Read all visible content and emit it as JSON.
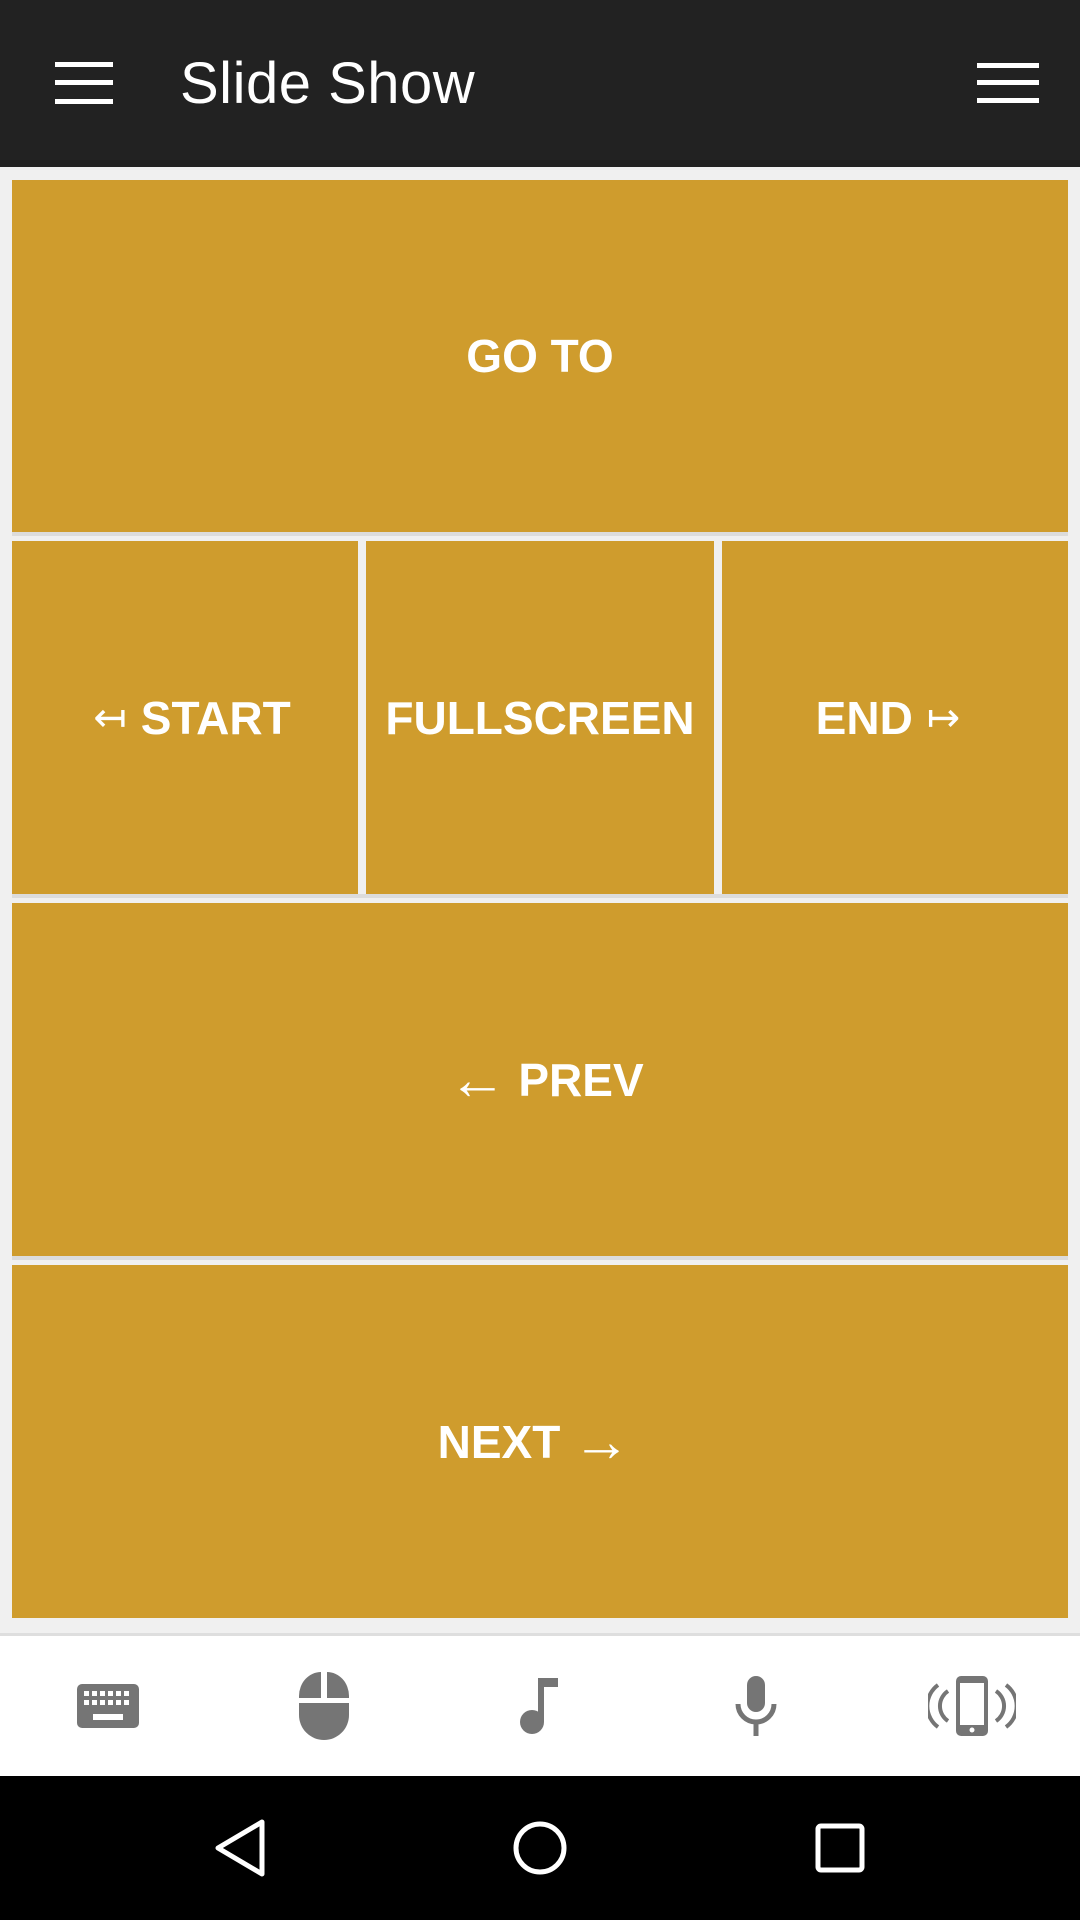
{
  "appbar": {
    "title": "Slide Show",
    "left_icon": "menu-icon",
    "right_icon": "menu-icon"
  },
  "controls": {
    "goto": {
      "label": "GO TO"
    },
    "start": {
      "arrow": "↤",
      "label": "START"
    },
    "fullscreen": {
      "label": "FULLSCREEN"
    },
    "end": {
      "label": "END",
      "arrow": "↦"
    },
    "prev": {
      "arrow": "←",
      "label": "PREV"
    },
    "next": {
      "label": "NEXT",
      "arrow": "→"
    }
  },
  "toolbar": {
    "items": [
      {
        "icon": "keyboard-icon"
      },
      {
        "icon": "mouse-icon"
      },
      {
        "icon": "music-note-icon"
      },
      {
        "icon": "microphone-icon"
      },
      {
        "icon": "phone-vibrate-icon"
      }
    ]
  },
  "navbar": {
    "items": [
      {
        "icon": "back-icon"
      },
      {
        "icon": "home-icon"
      },
      {
        "icon": "recents-icon"
      }
    ]
  },
  "colors": {
    "appbar": "#222222",
    "tile": "#cf9c2d",
    "tile_text": "#ffffff",
    "toolbar_icon": "#757575",
    "navbar": "#000000"
  }
}
